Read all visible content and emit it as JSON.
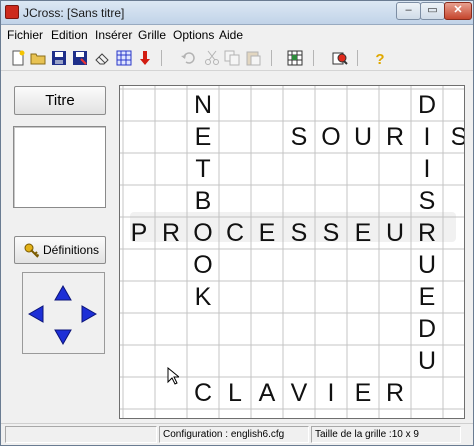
{
  "window": {
    "title": "JCross: [Sans titre]",
    "minimize_label": "–",
    "maximize_label": "▭",
    "close_label": "✕"
  },
  "menu": [
    "Fichier",
    "Edition",
    "Insérer",
    "Grille",
    "Options",
    "Aide"
  ],
  "toolbar": {
    "groups": [
      [
        "new-file-icon",
        "open-folder-icon",
        "save-icon",
        "save-as-icon",
        "eraser-icon",
        "grid-pattern-icon",
        "down-arrow-red-icon"
      ],
      [
        "undo-icon",
        "cut-icon",
        "copy-icon",
        "paste-icon"
      ],
      [
        "grid-settings-icon"
      ],
      [
        "print-preview-icon"
      ],
      [
        "help-question-icon"
      ]
    ],
    "disabled": [
      "undo-icon",
      "cut-icon",
      "copy-icon",
      "paste-icon"
    ]
  },
  "left_panel": {
    "title_button": "Titre",
    "definitions_button": "Définitions"
  },
  "grid": {
    "cols": 10,
    "rows": 9,
    "rows_content": [
      "  N      D",
      "  E  SOURIS",
      "  T      I",
      "  B      S",
      "PROCESSEUR",
      "  O      U",
      "  K      E",
      "         D",
      "         U",
      "  CLAVIER"
    ]
  },
  "status": {
    "configuration": "Configuration : english6.cfg",
    "grid_size": "Taille de la grille :10 x 9"
  },
  "colors": {
    "accent": "#1d2fd6",
    "close": "#c5452d"
  }
}
